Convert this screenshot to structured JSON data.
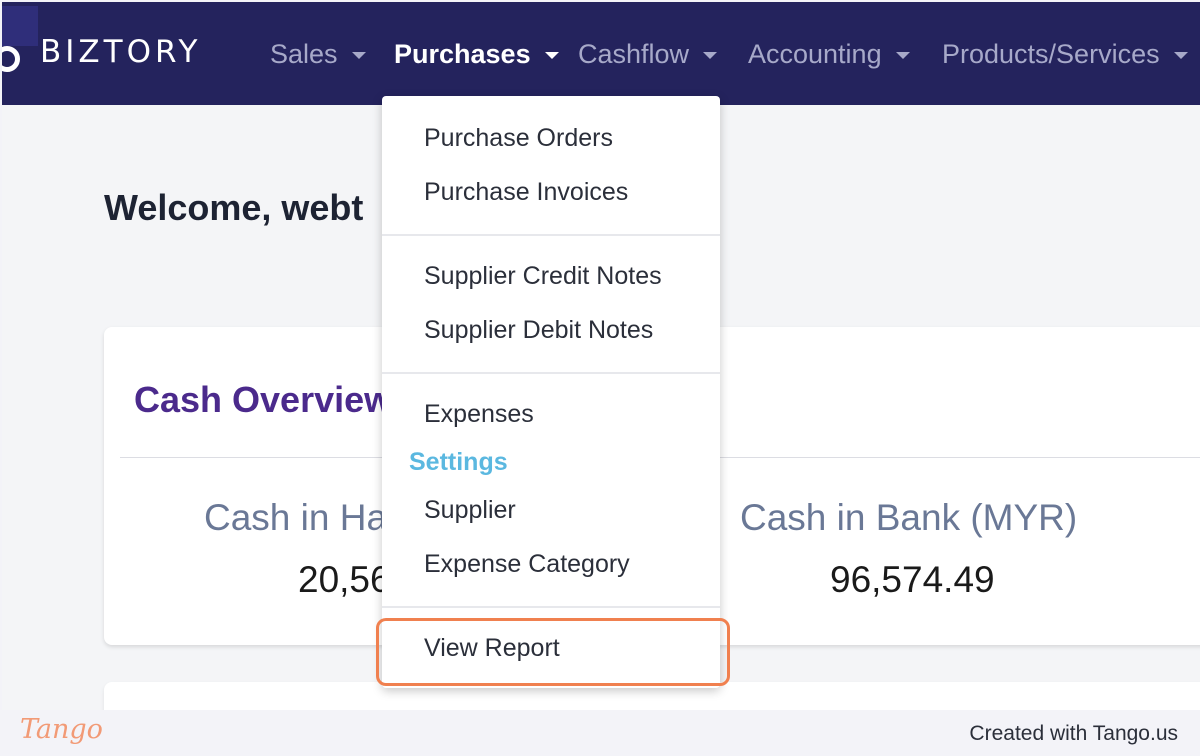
{
  "app": {
    "brand": "BIZTORY"
  },
  "nav": {
    "items": [
      {
        "label": "Sales"
      },
      {
        "label": "Purchases"
      },
      {
        "label": "Cashflow"
      },
      {
        "label": "Accounting"
      },
      {
        "label": "Products/Services"
      }
    ],
    "active": "Purchases"
  },
  "main": {
    "welcome": "Welcome, webt",
    "cash_overview": {
      "title": "Cash Overview",
      "cash_in_hand_label": "Cash in Ha",
      "cash_in_hand_value": "20,56",
      "cash_in_bank_label": "Cash in Bank (MYR)",
      "cash_in_bank_value": "96,574.49"
    }
  },
  "dropdown": {
    "purchase_orders": "Purchase Orders",
    "purchase_invoices": "Purchase Invoices",
    "supplier_credit_notes": "Supplier Credit Notes",
    "supplier_debit_notes": "Supplier Debit Notes",
    "expenses": "Expenses",
    "settings_header": "Settings",
    "supplier": "Supplier",
    "expense_category": "Expense Category",
    "view_report": "View Report"
  },
  "footer": {
    "brand": "Tango",
    "credit": "Created with Tango.us"
  },
  "colors": {
    "navbar": "#24235d",
    "accent_purple": "#4b2a8c",
    "settings_blue": "#5bb8e0",
    "highlight": "#f0804f"
  }
}
